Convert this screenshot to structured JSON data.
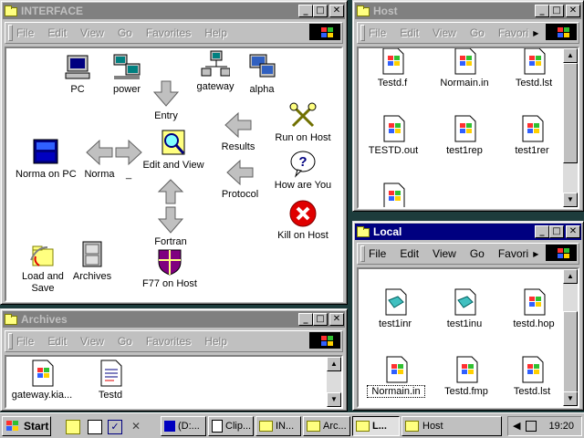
{
  "windows": {
    "interface": {
      "title": "INTERFACE",
      "menu": [
        "File",
        "Edit",
        "View",
        "Go",
        "Favorites",
        "Help"
      ],
      "icons": [
        {
          "label": "PC"
        },
        {
          "label": "power"
        },
        {
          "label": "gateway"
        },
        {
          "label": "alpha"
        },
        {
          "label": "Entry"
        },
        {
          "label": "Run on Host"
        },
        {
          "label": "Results"
        },
        {
          "label": "Norma on PC"
        },
        {
          "label": "Norma"
        },
        {
          "label": "_"
        },
        {
          "label": "Edit and View"
        },
        {
          "label": "How are You"
        },
        {
          "label": "Protocol"
        },
        {
          "label": "Fortran"
        },
        {
          "label": "Kill on Host"
        },
        {
          "label": "Load and Save"
        },
        {
          "label": "Archives"
        },
        {
          "label": "F77 on Host"
        }
      ]
    },
    "archives": {
      "title": "Archives",
      "menu": [
        "File",
        "Edit",
        "View",
        "Go",
        "Favorites",
        "Help"
      ],
      "icons": [
        {
          "label": "gateway.kia..."
        },
        {
          "label": "Testd"
        }
      ]
    },
    "host": {
      "title": "Host",
      "menu": [
        "File",
        "Edit",
        "View",
        "Go",
        "Favori"
      ],
      "icons": [
        {
          "label": "Testd.f"
        },
        {
          "label": "Normain.in"
        },
        {
          "label": "Testd.lst"
        },
        {
          "label": "TESTD.out"
        },
        {
          "label": "test1rep"
        },
        {
          "label": "test1rer"
        }
      ]
    },
    "local": {
      "title": "Local",
      "menu": [
        "File",
        "Edit",
        "View",
        "Go",
        "Favori"
      ],
      "icons": [
        {
          "label": "test1inr"
        },
        {
          "label": "test1inu"
        },
        {
          "label": "testd.hop"
        },
        {
          "label": "Normain.in"
        },
        {
          "label": "Testd.fmp"
        },
        {
          "label": "Testd.lst"
        }
      ]
    }
  },
  "taskbar": {
    "start": "Start",
    "tasks": [
      "(D:...",
      "Clip...",
      "IN...",
      "Arc...",
      "L...",
      "Host"
    ],
    "clock": "19:20"
  }
}
